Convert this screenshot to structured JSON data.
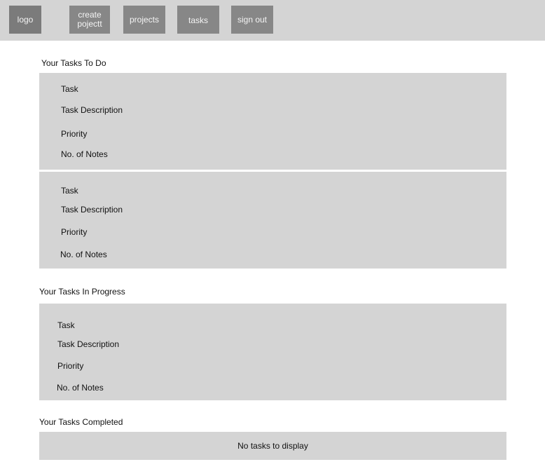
{
  "nav": {
    "logo": "logo",
    "create_project": "create pojectt",
    "projects": "projects",
    "tasks": "tasks",
    "sign_out": "sign out"
  },
  "sections": {
    "todo": {
      "title": "Your Tasks To Do",
      "tasks": [
        {
          "task": "Task",
          "description": "Task Description",
          "priority": "Priority",
          "notes": "No. of Notes"
        },
        {
          "task": "Task",
          "description": "Task Description",
          "priority": "Priority",
          "notes": "No. of Notes"
        }
      ]
    },
    "in_progress": {
      "title": "Your Tasks In Progress",
      "tasks": [
        {
          "task": "Task",
          "description": "Task Description",
          "priority": "Priority",
          "notes": "No. of Notes"
        }
      ]
    },
    "completed": {
      "title": "Your Tasks Completed",
      "empty_message": "No tasks to display"
    }
  }
}
